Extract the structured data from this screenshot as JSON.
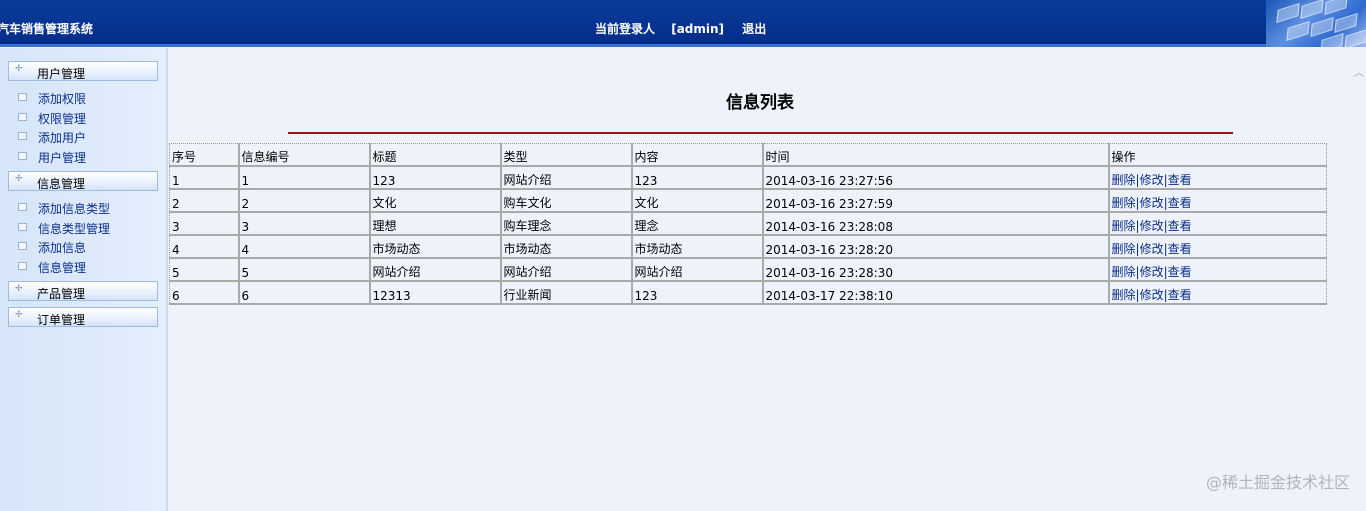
{
  "header": {
    "app_title": "汽车销售管理系统",
    "current_user_label": "当前登录人",
    "current_user_name": "[admin]",
    "logout_label": "退出"
  },
  "sidebar": {
    "groups": [
      {
        "label": "用户管理",
        "items": [
          "添加权限",
          "权限管理",
          "添加用户",
          "用户管理"
        ]
      },
      {
        "label": "信息管理",
        "items": [
          "添加信息类型",
          "信息类型管理",
          "添加信息",
          "信息管理"
        ]
      },
      {
        "label": "产品管理",
        "items": []
      },
      {
        "label": "订单管理",
        "items": []
      }
    ]
  },
  "main": {
    "title": "信息列表",
    "table": {
      "headers": [
        "序号",
        "信息编号",
        "标题",
        "类型",
        "内容",
        "时间",
        "操作"
      ],
      "ops": {
        "delete": "删除",
        "edit": "修改",
        "view": "查看",
        "separator": "|"
      },
      "rows": [
        [
          "1",
          "1",
          "123",
          "网站介绍",
          "123",
          "2014-03-16 23:27:56"
        ],
        [
          "2",
          "2",
          "文化",
          "购车文化",
          "文化",
          "2014-03-16 23:27:59"
        ],
        [
          "3",
          "3",
          "理想",
          "购车理念",
          "理念",
          "2014-03-16 23:28:08"
        ],
        [
          "4",
          "4",
          "市场动态",
          "市场动态",
          "市场动态",
          "2014-03-16 23:28:20"
        ],
        [
          "5",
          "5",
          "网站介绍",
          "网站介绍",
          "网站介绍",
          "2014-03-16 23:28:30"
        ],
        [
          "6",
          "6",
          "12313",
          "行业新闻",
          "123",
          "2014-03-17 22:38:10"
        ]
      ]
    }
  },
  "watermark": "@稀土掘金技术社区",
  "colors": {
    "header_bg": "#063391",
    "title_rule": "#a01010",
    "link": "#0b2d87"
  }
}
